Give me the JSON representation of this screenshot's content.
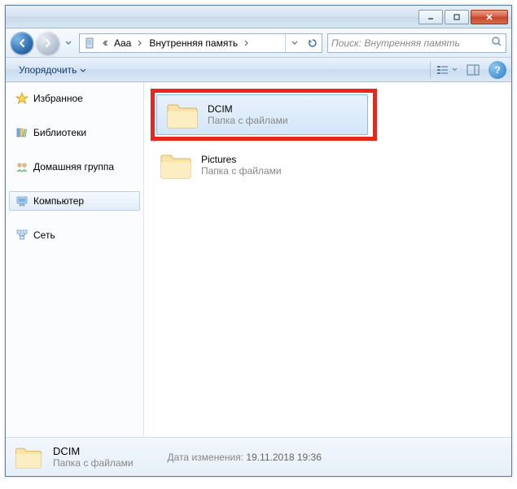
{
  "breadcrumbs": [
    "Aaa",
    "Внутренняя память"
  ],
  "search": {
    "placeholder": "Поиск: Внутренняя память"
  },
  "toolbar": {
    "organize": "Упорядочить"
  },
  "sidebar": {
    "items": [
      {
        "label": "Избранное",
        "icon": "star"
      },
      {
        "label": "Библиотеки",
        "icon": "lib"
      },
      {
        "label": "Домашняя группа",
        "icon": "home"
      },
      {
        "label": "Компьютер",
        "icon": "pc"
      },
      {
        "label": "Сеть",
        "icon": "net"
      }
    ]
  },
  "content": {
    "items": [
      {
        "name": "DCIM",
        "sub": "Папка с файлами",
        "selected": true,
        "highlighted": true
      },
      {
        "name": "Pictures",
        "sub": "Папка с файлами",
        "selected": false,
        "highlighted": false
      }
    ]
  },
  "status": {
    "name": "DCIM",
    "sub": "Папка с файлами",
    "date_label": "Дата изменения:",
    "date_value": "19.11.2018 19:36"
  }
}
